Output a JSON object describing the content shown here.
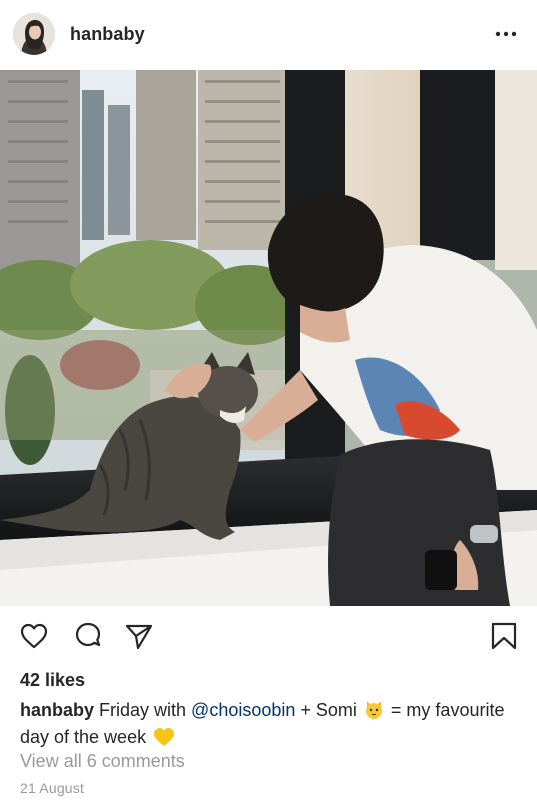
{
  "post": {
    "username": "hanbaby",
    "more_icon": "more-horizontal-icon",
    "likes": "42 likes",
    "caption": {
      "user": "hanbaby",
      "text_before": " Friday with ",
      "mention": "@choisoobin",
      "text_middle": " + Somi ",
      "emoji_1": "cat-face-emoji",
      "text_after": " = my favourite day of the week ",
      "emoji_2": "yellow-heart-emoji"
    },
    "view_comments": "View all 6 comments",
    "date": "21 August"
  },
  "icons": {
    "like": "heart-icon",
    "comment": "comment-icon",
    "share": "send-icon",
    "save": "bookmark-icon"
  },
  "colors": {
    "text": "#262626",
    "mention": "#003569",
    "muted": "#999999"
  }
}
